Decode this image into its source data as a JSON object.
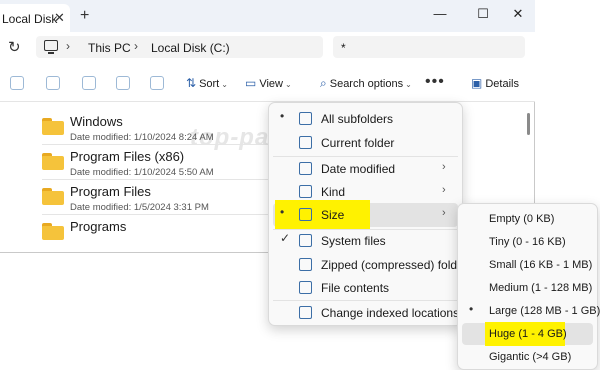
{
  "tab": {
    "title": "Local Disk",
    "close_glyph": "✕",
    "new_glyph": "+"
  },
  "window_controls": {
    "minimize": "—",
    "maximize": "☐",
    "close": "✕"
  },
  "address": {
    "refresh_glyph": "↻",
    "sep_glyph": "›",
    "breadcrumbs": [
      "This PC",
      "Local Disk (C:)"
    ],
    "search_value": "*"
  },
  "toolbar": {
    "sort_label": "Sort",
    "view_label": "View",
    "search_options_label": "Search options",
    "more_glyph": "•••",
    "details_label": "Details",
    "caret_glyph": "⌄",
    "watermark": "top-password.com"
  },
  "files": [
    {
      "name": "Windows",
      "meta": "Date modified: 1/10/2024 8:24 AM"
    },
    {
      "name": "Program Files (x86)",
      "meta": "Date modified: 1/10/2024 5:50 AM"
    },
    {
      "name": "Program Files",
      "meta": "Date modified: 1/5/2024 3:31 PM"
    },
    {
      "name": "Programs",
      "meta": ""
    }
  ],
  "search_options_menu": {
    "items": [
      {
        "label": "All subfolders",
        "mark": "•",
        "icon": "subfolders-icon"
      },
      {
        "label": "Current folder",
        "mark": "",
        "icon": "folder-icon"
      },
      {
        "label": "Date modified",
        "mark": "",
        "icon": "calendar-icon",
        "arrow": "›"
      },
      {
        "label": "Kind",
        "mark": "",
        "icon": "kind-icon",
        "arrow": "›"
      },
      {
        "label": "Size",
        "mark": "•",
        "icon": "size-icon",
        "arrow": "›",
        "highlighted": true
      },
      {
        "label": "System files",
        "mark": "✓",
        "icon": "system-files-icon"
      },
      {
        "label": "Zipped (compressed) folders",
        "mark": "",
        "icon": "zip-folder-icon"
      },
      {
        "label": "File contents",
        "mark": "",
        "icon": "file-contents-icon"
      },
      {
        "label": "Change indexed locations",
        "mark": "",
        "icon": "index-locations-icon"
      }
    ]
  },
  "size_submenu": {
    "items": [
      {
        "label": "Empty (0 KB)",
        "mark": ""
      },
      {
        "label": "Tiny (0 - 16 KB)",
        "mark": ""
      },
      {
        "label": "Small (16 KB - 1 MB)",
        "mark": ""
      },
      {
        "label": "Medium (1 - 128 MB)",
        "mark": ""
      },
      {
        "label": "Large (128 MB - 1 GB)",
        "mark": "•"
      },
      {
        "label": "Huge (1 - 4 GB)",
        "mark": "",
        "highlighted": true
      },
      {
        "label": "Gigantic (>4 GB)",
        "mark": ""
      }
    ]
  },
  "colors": {
    "highlight": "#fff200",
    "accent": "#2b5fa8",
    "folder": "#f5c33b"
  }
}
